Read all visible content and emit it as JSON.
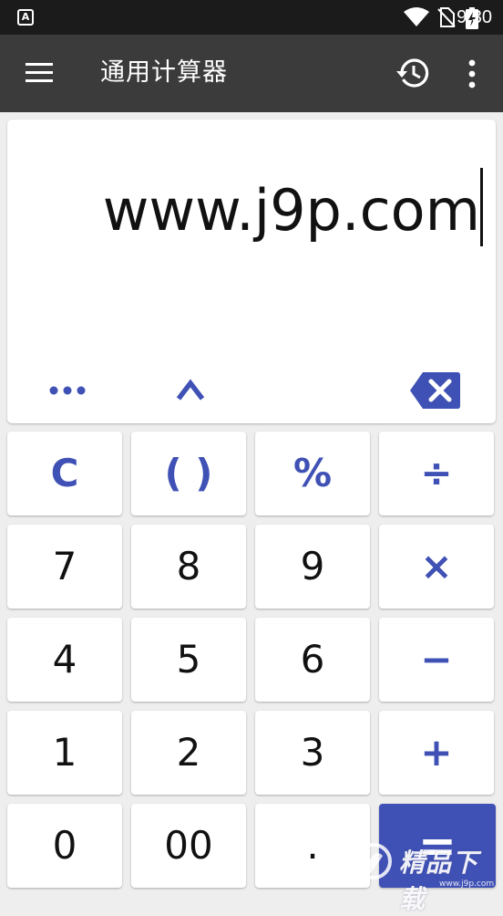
{
  "status_bar": {
    "time": "9:30",
    "icons": [
      "notification-a-icon",
      "wifi-icon",
      "no-sim-icon",
      "battery-charging-icon"
    ],
    "notification_glyph": "A"
  },
  "app_bar": {
    "title": "通用计算器",
    "menu_icon": "hamburger-menu-icon",
    "history_icon": "history-icon",
    "more_icon": "more-vert-icon"
  },
  "display": {
    "expression": "www.j9p.com",
    "func_buttons": [
      "more-functions",
      "inverse",
      "backspace"
    ]
  },
  "keypad": {
    "rows": [
      [
        {
          "label": "C",
          "type": "accent"
        },
        {
          "label": "( )",
          "type": "accent"
        },
        {
          "label": "%",
          "type": "accent"
        },
        {
          "label": "÷",
          "type": "accent"
        }
      ],
      [
        {
          "label": "7",
          "type": "digit"
        },
        {
          "label": "8",
          "type": "digit"
        },
        {
          "label": "9",
          "type": "digit"
        },
        {
          "label": "×",
          "type": "accent"
        }
      ],
      [
        {
          "label": "4",
          "type": "digit"
        },
        {
          "label": "5",
          "type": "digit"
        },
        {
          "label": "6",
          "type": "digit"
        },
        {
          "label": "−",
          "type": "accent"
        }
      ],
      [
        {
          "label": "1",
          "type": "digit"
        },
        {
          "label": "2",
          "type": "digit"
        },
        {
          "label": "3",
          "type": "digit"
        },
        {
          "label": "+",
          "type": "accent"
        }
      ],
      [
        {
          "label": "0",
          "type": "digit"
        },
        {
          "label": "00",
          "type": "digit"
        },
        {
          "label": ".",
          "type": "digit"
        },
        {
          "label": "=",
          "type": "equals"
        }
      ]
    ]
  },
  "watermark": {
    "text": "精品下载",
    "url": "www.j9p.com"
  },
  "colors": {
    "accent": "#3f51b5",
    "app_bar": "#3b3b3b",
    "status_bar": "#1b1b1b",
    "background": "#eeeeee"
  }
}
